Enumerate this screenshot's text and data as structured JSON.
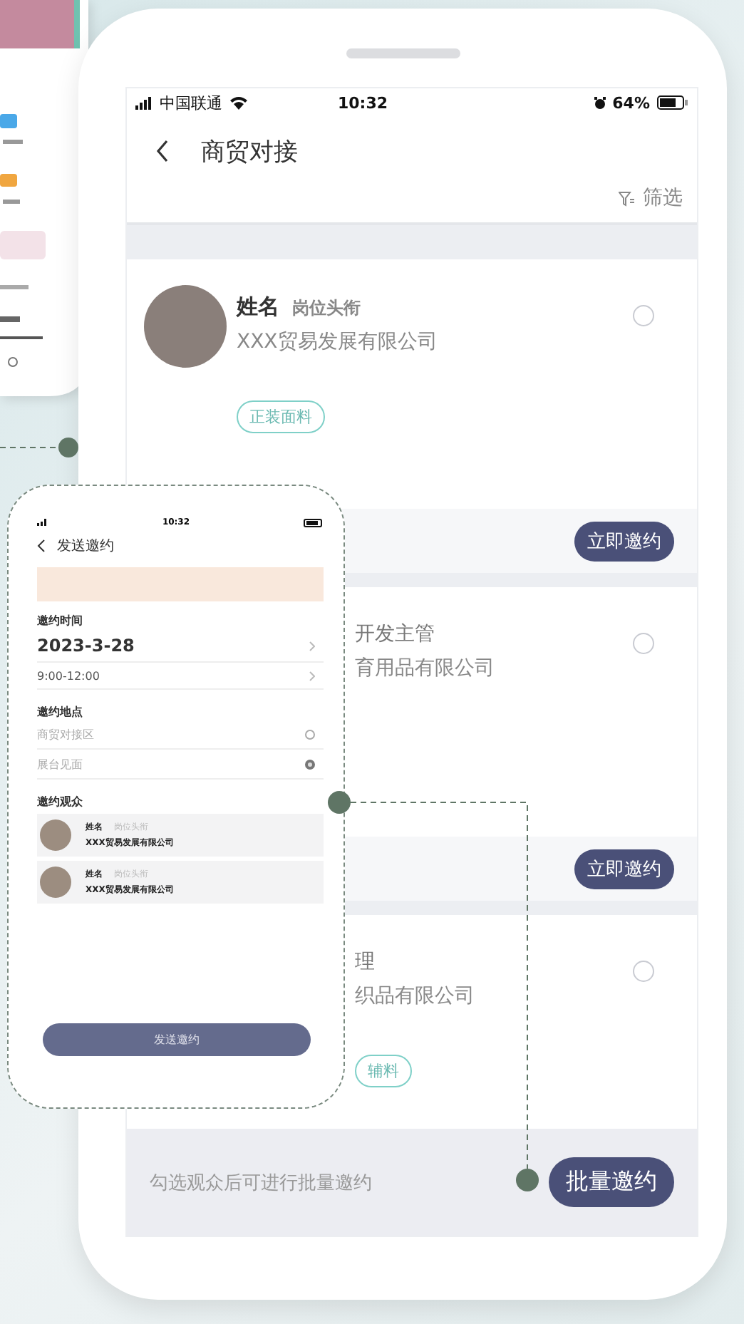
{
  "main_screen": {
    "status_bar": {
      "carrier": "中国联通",
      "time": "10:32",
      "battery": "64%"
    },
    "title": "商贸对接",
    "filter": "筛选",
    "cards": [
      {
        "name": "姓名",
        "position": "岗位头衔",
        "company": "XXX贸易发展有限公司",
        "tag": "正装面料",
        "selected": false,
        "button": "立即邀约"
      },
      {
        "position": "开发主管",
        "company": "育用品有限公司",
        "selected": false,
        "button": "立即邀约"
      },
      {
        "position": "理",
        "company": "织品有限公司",
        "tag": "辅料",
        "selected": false
      }
    ],
    "footer": {
      "hint": "勾选观众后可进行批量邀约",
      "button": "批量邀约"
    }
  },
  "invite_screen": {
    "time": "10:32",
    "title": "发送邀约",
    "time_label": "邀约时间",
    "date": "2023-3-28",
    "hours": "9:00-12:00",
    "place_label": "邀约地点",
    "places": [
      {
        "label": "商贸对接区",
        "selected": false
      },
      {
        "label": "展台见面",
        "selected": true
      }
    ],
    "audience_label": "邀约观众",
    "audience": [
      {
        "name": "姓名",
        "position": "岗位头衔",
        "company": "XXX贸易发展有限公司"
      },
      {
        "name": "姓名",
        "position": "岗位头衔",
        "company": "XXX贸易发展有限公司"
      }
    ],
    "button": "发送邀约"
  }
}
